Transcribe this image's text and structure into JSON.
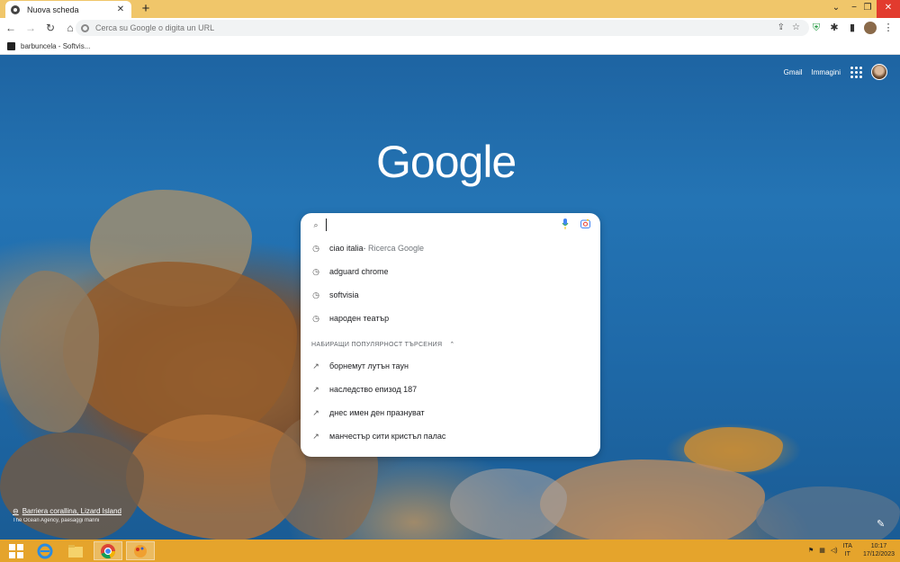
{
  "browser": {
    "tab_title": "Nuova scheda",
    "tab_close": "✕",
    "new_tab": "+",
    "window_controls": {
      "dropdown": "⌄",
      "minimize": "−",
      "maximize": "❐",
      "close": "✕"
    },
    "omnibox_placeholder": "Cerca su Google o digita un URL",
    "bookmark": "barbuncela - Softvis..."
  },
  "page": {
    "gmail": "Gmail",
    "images": "Immagini",
    "logo": "Google"
  },
  "search": {
    "input_value": "",
    "history": [
      {
        "text": "ciao italia",
        "sub": " - Ricerca Google"
      },
      {
        "text": "adguard chrome",
        "sub": ""
      },
      {
        "text": "softvisia",
        "sub": ""
      },
      {
        "text": "народен театър",
        "sub": ""
      }
    ],
    "trending_header": "НАБИРАЩИ ПОПУЛЯРНОСТ ТЪРСЕНИЯ",
    "trending": [
      "борнемут лутън таун",
      "наследство епизод 187",
      "днес имен ден празнуват",
      "манчестър сити кристъл палас"
    ]
  },
  "attribution": {
    "title": "Barriera corallina, Lizard Island",
    "credit": "The Ocean Agency, paesaggi marini"
  },
  "taskbar": {
    "lang_top": "ITA",
    "lang_bottom": "IT",
    "time": "10:17",
    "date": "17/12/2023"
  }
}
